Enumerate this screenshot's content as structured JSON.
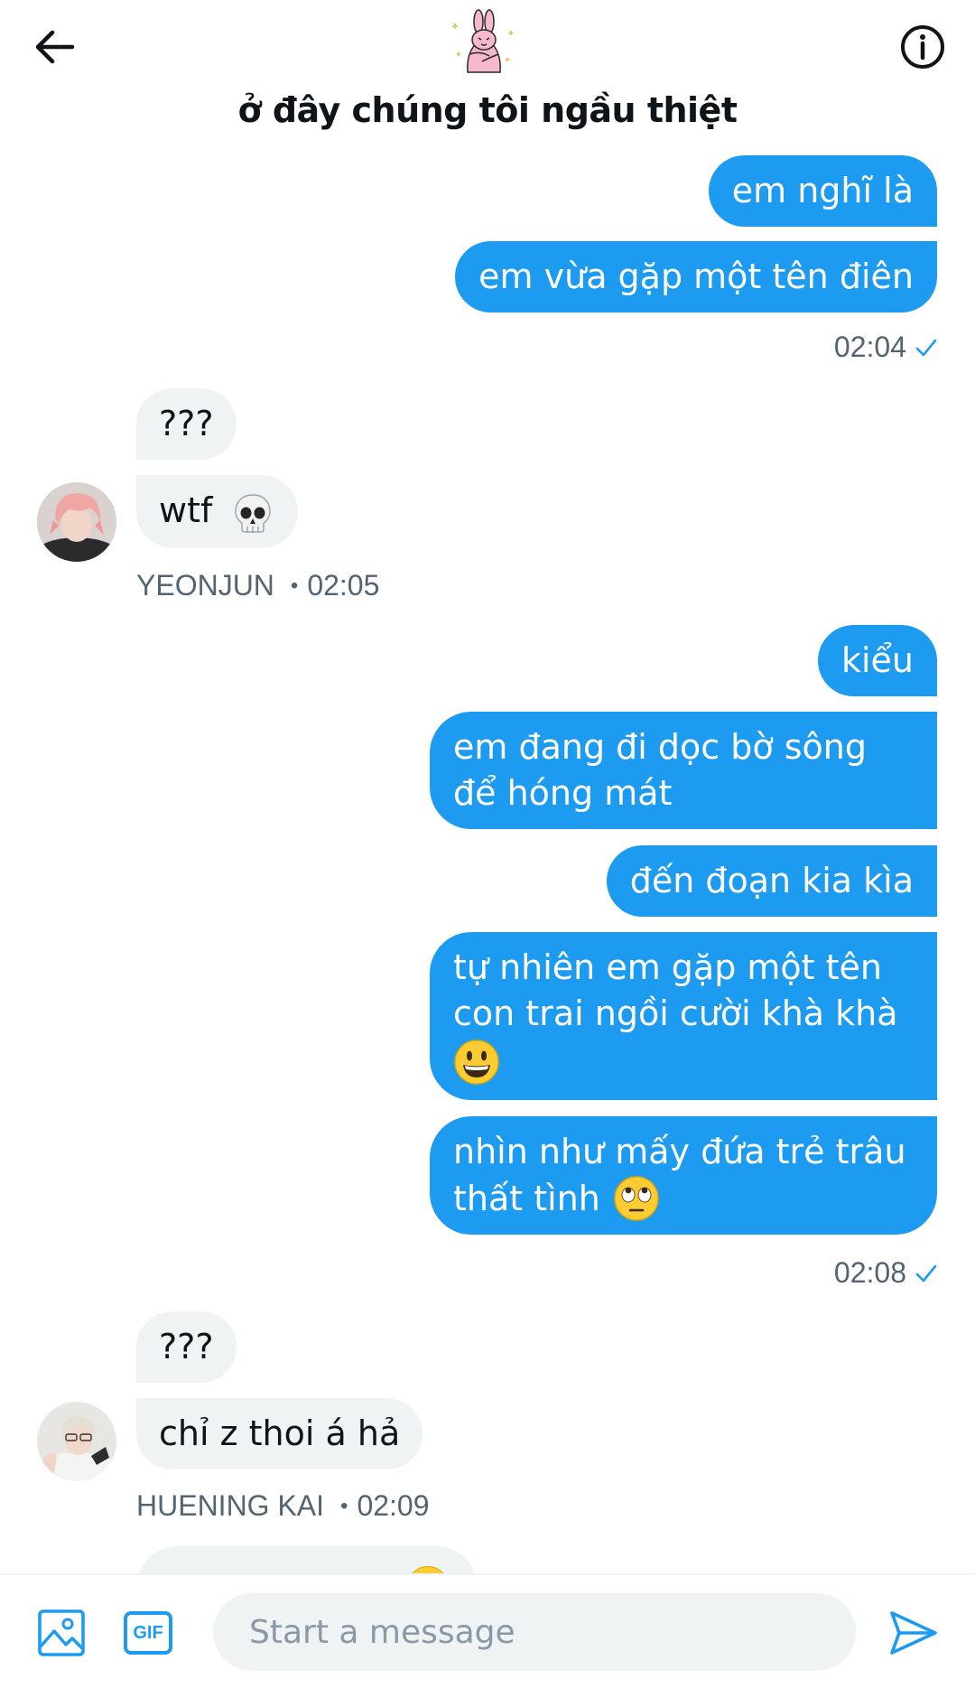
{
  "header": {
    "title": "ở đây chúng tôi ngầu thiệt",
    "back_icon": "arrow-left-icon",
    "info_icon": "info-icon",
    "group_avatar": "pink-bunny-sticker"
  },
  "messages": {
    "m1": "em nghĩ là",
    "m2": "em vừa gặp một tên điên",
    "t1": "02:04",
    "y1": "???",
    "y2": "wtf",
    "y_name": "YEONJUN",
    "y_time": "02:05",
    "m3": "kiểu",
    "m4_l1": "em đang đi dọc bờ sông",
    "m4_l2": "để hóng mát",
    "m5": "đến đoạn kia kìa",
    "m6_l1": "tự nhiên em gặp một tên",
    "m6_l2": "con trai ngồi cười khà khà",
    "m7_l1": "nhìn như mấy đứa trẻ trâu",
    "m7_l2": "thất tình",
    "t2": "02:08",
    "h1": "???",
    "h2": "chỉ z thoi á hả",
    "h_name": "HUENING KAI",
    "h_time": "02:09"
  },
  "composer": {
    "placeholder": "Start a message",
    "gif_label": "GIF"
  },
  "colors": {
    "accent": "#1d9bf0",
    "incoming_bg": "#eff3f4",
    "meta_text": "#536471"
  }
}
